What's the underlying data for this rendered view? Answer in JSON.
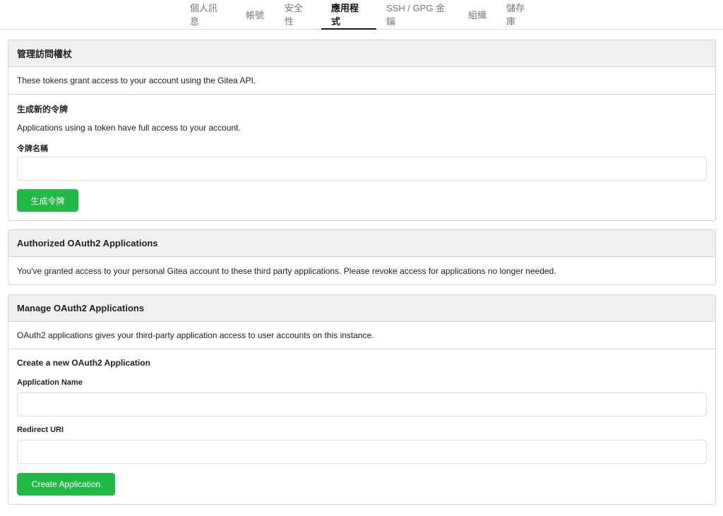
{
  "nav": {
    "tabs": [
      {
        "label": "個人訊息"
      },
      {
        "label": "帳號"
      },
      {
        "label": "安全性"
      },
      {
        "label": "應用程式"
      },
      {
        "label": "SSH / GPG 金鑰"
      },
      {
        "label": "組織"
      },
      {
        "label": "儲存庫"
      }
    ],
    "active_tab": "應用程式"
  },
  "tokens": {
    "title": "管理訪問權杖",
    "description": "These tokens grant access to your account using the Gitea API.",
    "form": {
      "title": "生成新的令牌",
      "description": "Applications using a token have full access to your account.",
      "name_label": "令牌名稱",
      "name_value": "",
      "submit_label": "生成令牌"
    }
  },
  "authorized_oauth2": {
    "title": "Authorized OAuth2 Applications",
    "description": "You've granted access to your personal Gitea account to these third party applications. Please revoke access for applications no longer needed."
  },
  "manage_oauth2": {
    "title": "Manage OAuth2 Applications",
    "description": "OAuth2 applications gives your third-party application access to user accounts on this instance.",
    "form": {
      "title": "Create a new OAuth2 Application",
      "app_name_label": "Application Name",
      "app_name_value": "",
      "redirect_label": "Redirect URI",
      "redirect_value": "",
      "submit_label": "Create Application"
    }
  },
  "colors": {
    "primary_button": "#21ba45",
    "header_bg": "#f0f0f0",
    "border": "#d4d4d5"
  }
}
